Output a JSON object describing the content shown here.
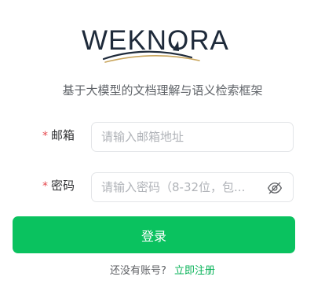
{
  "brand": {
    "logo_text": "WEKNORA",
    "tagline": "基于大模型的文档理解与语义检索框架"
  },
  "form": {
    "required_mark": "*",
    "email": {
      "label": "邮箱",
      "placeholder": "请输入邮箱地址",
      "value": ""
    },
    "password": {
      "label": "密码",
      "placeholder": "请输入密码（8-32位，包...",
      "value": "",
      "toggle_icon": "eye-off-icon"
    },
    "submit_label": "登录"
  },
  "footer": {
    "prompt": "还没有账号?",
    "signup_label": "立即注册"
  },
  "colors": {
    "primary": "#0ac25f",
    "link": "#0ab35a",
    "required": "#e5484d",
    "logo": "#1e2a3a",
    "logo_accent": "#c9a55c"
  }
}
